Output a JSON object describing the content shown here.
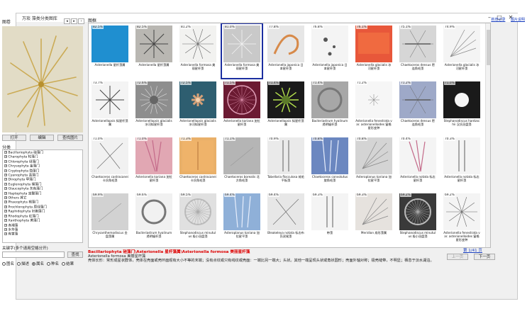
{
  "window": {
    "title": "万琰 藻类分类图库",
    "minimize": "–",
    "maximize": "□",
    "close": "✕"
  },
  "links": [
    "新增记录",
    "图片说明"
  ],
  "left": {
    "header": "图卷",
    "nav": [
      "◂",
      "▸",
      "‹"
    ],
    "buttons": [
      "打开",
      "编辑",
      "查找图片"
    ],
    "category_label": "分类",
    "tree": [
      "Bacillariophyta 硅藻门",
      "Charophyta 轮藻门",
      "Chlorophyta 绿藻门",
      "Chrysophyta 金藻门",
      "Cryptophyta 隐藻门",
      "Cyanophyta 蓝藻门",
      "Dinophyta 甲藻门",
      "Euglenophyta 裸藻门",
      "Glaucophyta 灰色藻门",
      "Haptophyta 定鞭藻门",
      "Others 其它",
      "Phaeophyta 褐藻门",
      "Prochlorophyta 原绿藻门",
      "Raphidophyta 针胞藻门",
      "Rhodophyta 红藻门",
      "Xanthophyta 黄藻门",
      "赤潮藻",
      "水华藻",
      "有害藻"
    ],
    "keyword_label": "关键字(多个请用空格分开)",
    "search_button": "查找",
    "radios": [
      {
        "label": "图名",
        "selected": false
      },
      {
        "label": "描述",
        "selected": false
      },
      {
        "label": "属名",
        "selected": true
      },
      {
        "label": "种名",
        "selected": false
      },
      {
        "label": "结果",
        "selected": false
      }
    ]
  },
  "gallery": {
    "label": "图框",
    "selected_index": 2,
    "items": [
      {
        "pct": "82.5%",
        "caption": "Asterionella 星杆藻属",
        "bg": "#2aa6d8",
        "art": "blue"
      },
      {
        "pct": "82.5%",
        "caption": "Asterionella 星杆藻属",
        "bg": "#b9b7b2",
        "art": "star-dark"
      },
      {
        "pct": "81.2%",
        "caption": "Asterionella formosa 美丽星杆藻",
        "bg": "#f2f2f0",
        "art": "star-thin"
      },
      {
        "pct": "81.0%",
        "caption": "Asterionella formosa 美丽星杆藻",
        "bg": "#c9c9c9",
        "art": "star-light"
      },
      {
        "pct": "77.8%",
        "caption": "Asterionella japonica 日本星杆藻",
        "bg": "#e6e6e6",
        "art": "spiral"
      },
      {
        "pct": "76.8%",
        "caption": "Asterionella japonica 日本星杆藻",
        "bg": "#f4f4f4",
        "art": "dots"
      },
      {
        "pct": "76.1%",
        "caption": "Asterionella glacialis 冰河星杆藻",
        "bg": "#e8573a",
        "art": "red"
      },
      {
        "pct": "75.1%",
        "caption": "Chaetoceros densus 密连角毛藻",
        "bg": "#d6d6d6",
        "art": "chain"
      },
      {
        "pct": "74.9%",
        "caption": "Asterionella glacialis 冰河星杆藻",
        "bg": "#f4f4f4",
        "art": "fan"
      },
      {
        "pct": "73.7%",
        "caption": "Asterionellopsis 拟星杆藻属",
        "bg": "#f4f4f4",
        "art": "star-dark"
      },
      {
        "pct": "72.6%",
        "caption": "Asterionellopsis glacialis 冰河拟星杆藻",
        "bg": "#8e8e8e",
        "art": "spiky"
      },
      {
        "pct": "72.5%",
        "caption": "Asterionellopsis glacialis 冰河拟星杆藻",
        "bg": "#2e5e70",
        "art": "flower"
      },
      {
        "pct": "71.5%",
        "caption": "Asterionella kariana 加拉星杆藻",
        "bg": "#6b1a32",
        "art": "circle-pink"
      },
      {
        "pct": "71.4%",
        "caption": "Asterionellopsis 拟星杆藻属",
        "bg": "#1a1a1a",
        "art": "green"
      },
      {
        "pct": "71.4%",
        "caption": "Bacteriastrum hyalinum 透明辐杆藻",
        "bg": "#a7a7a7",
        "art": "ring"
      },
      {
        "pct": "71.2%",
        "caption": "Asterionella fenestrata var. asterionelloides 窗格星形变种",
        "bg": "#f6f6f6",
        "art": "small-star"
      },
      {
        "pct": "71.2%",
        "caption": "Chaetoceros densus 密连角毛藻",
        "bg": "#9ea9c8",
        "art": "chain"
      },
      {
        "pct": "71.0%",
        "caption": "Stephanodiscus hantzschii 汉氏冠盘藻",
        "bg": "#1a1a1a",
        "art": "bright"
      },
      {
        "pct": "71.0%",
        "caption": "Chaetoceros castracanei 卡氏角毛藻",
        "bg": "#f1f1f1",
        "art": "cross"
      },
      {
        "pct": "71.0%",
        "caption": "Asterionella kariana 加拉星杆藻",
        "bg": "#e1a7b3",
        "art": "pink-rods"
      },
      {
        "pct": "71.3%",
        "caption": "Chaetoceros castracanei 卡氏角毛藻",
        "bg": "#e9b069",
        "art": "orange"
      },
      {
        "pct": "71.1%",
        "caption": "Chaetoceros borealis 北方角毛藻",
        "bg": "#b5b5b5",
        "art": "plain"
      },
      {
        "pct": "70.9%",
        "caption": "Tabellaria flocculosa 绒毛平板藻",
        "bg": "#eaeaea",
        "art": "rods-v"
      },
      {
        "pct": "70.8%",
        "caption": "Chaetoceros convolutus 旋角毛藻",
        "bg": "#6b87c0",
        "art": "blue-rods"
      },
      {
        "pct": "70.8%",
        "caption": "Asteroplanus kariana 加拉星平藻",
        "bg": "#d4d4d4",
        "art": "fan"
      },
      {
        "pct": "70.4%",
        "caption": "Asterionella notata 标志星杆藻",
        "bg": "#f4f4f4",
        "art": "pink-rods"
      },
      {
        "pct": "70.3%",
        "caption": "Asterionella notata 标志星杆藻",
        "bg": "#f4f4f4",
        "art": "rods-v"
      },
      {
        "pct": "69.9%",
        "caption": "Chrysanthemodiscus 金盘藻属",
        "bg": "#d2d2d2",
        "art": "plain"
      },
      {
        "pct": "69.6%",
        "caption": "Bacteriastrum hyalinum 透明辐杆藻",
        "bg": "#f1f1f1",
        "art": "ring"
      },
      {
        "pct": "69.5%",
        "caption": "Stephanodiscus minutulus 极小冠盘藻",
        "bg": "#e0e0e0",
        "art": "disc"
      },
      {
        "pct": "69.4%",
        "caption": "Asteroplanus kariana 加拉星平藻",
        "bg": "#8fb0d8",
        "art": "blue-rods"
      },
      {
        "pct": "69.4%",
        "caption": "Bleakeleya notata 标志布氏双尾藻",
        "bg": "#e7e7e7",
        "art": "cross"
      },
      {
        "pct": "69.3%",
        "caption": "带藻",
        "bg": "#f4f4f4",
        "art": "rods-v"
      },
      {
        "pct": "69.3%",
        "caption": "Meridion 扇形藻属",
        "bg": "#e6e2de",
        "art": "fan"
      },
      {
        "pct": "69.2%",
        "caption": "Stephanodiscus minutulus 极小冠盘藻",
        "bg": "#3a3a3a",
        "art": "disc"
      },
      {
        "pct": "69.2%",
        "caption": "Asterionella fenestrata var. asterionelloides 窗格星形变种",
        "bg": "#f4f4f4",
        "art": "star-thin"
      }
    ]
  },
  "detail": {
    "classification": "Bacillariophyta 硅藻门\\Asterionella 星杆藻属\\Asterionella formosa 美丽星杆藻",
    "scientific_name": "Asterionella formosa 美丽星杆藻",
    "description": "壳体长形：常形成星状群体，壳体在壳面或壳环面观有大小不等的末端；没有点纹或只有线纹或壳面：一端比另一端大；头状。其他一端呈现头状或角状圆形；壳面外轴对称；极壳缝带，不明显；栖息于淡水湖泊。"
  },
  "pager": {
    "page": "第 1/41 页",
    "prev": "上一页",
    "next": "下一页"
  }
}
